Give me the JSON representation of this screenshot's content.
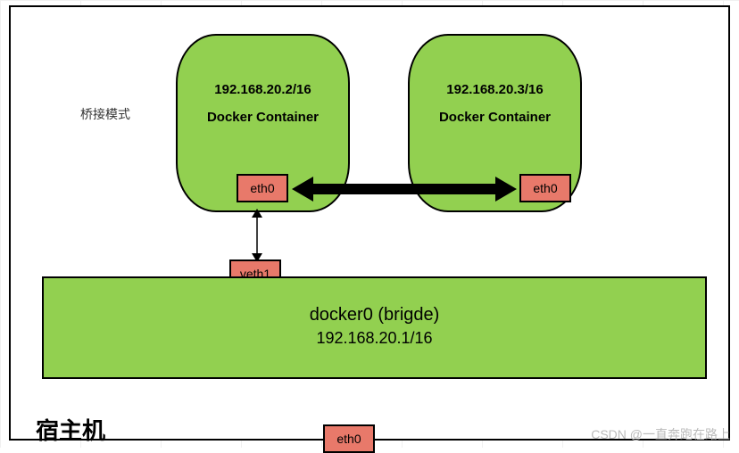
{
  "bridge_mode_label": "桥接模式",
  "container1": {
    "ip": "192.168.20.2/16",
    "title": "Docker Container",
    "eth": "eth0"
  },
  "container2": {
    "ip": "192.168.20.3/16",
    "title": "Docker Container",
    "eth": "eth0"
  },
  "veth1_label": "veth1",
  "docker0": {
    "title": "docker0  (brigde)",
    "ip": "192.168.20.1/16"
  },
  "host_eth": "eth0",
  "host_label": "宿主机",
  "watermark": "CSDN @一直奔跑在路上",
  "colors": {
    "container_fill": "#92d050",
    "eth_fill": "#e8796a",
    "border": "#000000"
  }
}
